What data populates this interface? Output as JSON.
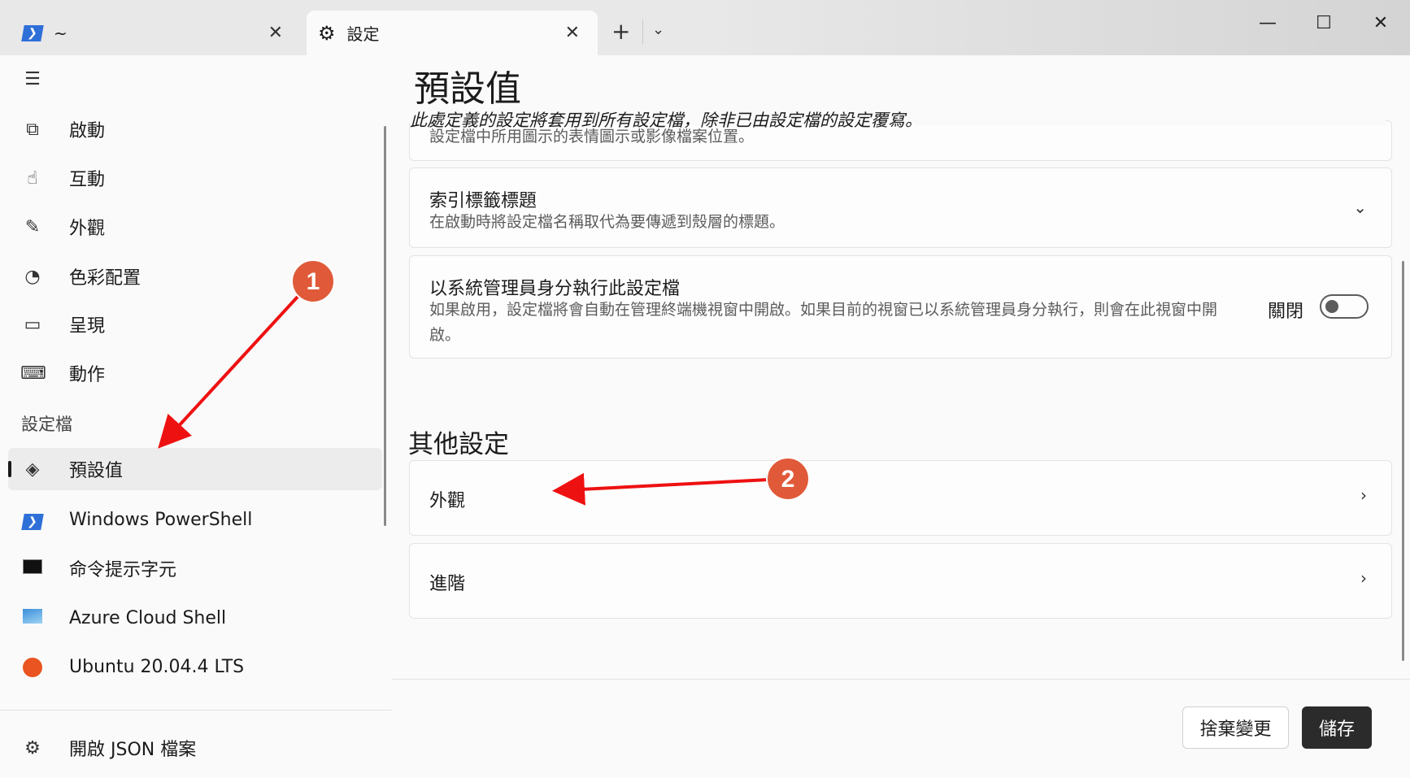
{
  "tabs": [
    {
      "label": "~",
      "icon": "powershell-icon"
    },
    {
      "label": "設定",
      "icon": "gear-icon"
    }
  ],
  "window_controls": {
    "minimize": "—",
    "maximize": "☐",
    "close": "✕"
  },
  "sidebar": {
    "items": [
      {
        "label": "啟動",
        "icon": "startup-icon"
      },
      {
        "label": "互動",
        "icon": "interaction-icon"
      },
      {
        "label": "外觀",
        "icon": "brush-icon"
      },
      {
        "label": "色彩配置",
        "icon": "palette-icon"
      },
      {
        "label": "呈現",
        "icon": "laptop-icon"
      },
      {
        "label": "動作",
        "icon": "keyboard-icon"
      }
    ],
    "profiles_header": "設定檔",
    "profiles": [
      {
        "label": "預設值",
        "icon": "layers-icon",
        "selected": true
      },
      {
        "label": "Windows PowerShell",
        "icon": "powershell-icon"
      },
      {
        "label": "命令提示字元",
        "icon": "cmd-icon"
      },
      {
        "label": "Azure Cloud Shell",
        "icon": "azure-icon"
      },
      {
        "label": "Ubuntu 20.04.4 LTS",
        "icon": "ubuntu-icon"
      }
    ],
    "open_json": "開啟 JSON 檔案"
  },
  "main": {
    "title": "預設值",
    "subtitle": "此處定義的設定將套用到所有設定檔，除非已由設定檔的設定覆寫。",
    "partial_card_desc": "設定檔中所用圖示的表情圖示或影像檔案位置。",
    "tab_title_card": {
      "title": "索引標籤標題",
      "desc": "在啟動時將設定檔名稱取代為要傳遞到殼層的標題。"
    },
    "elevate_card": {
      "title": "以系統管理員身分執行此設定檔",
      "desc": "如果啟用，設定檔將會自動在管理終端機視窗中開啟。如果目前的視窗已以系統管理員身分執行，則會在此視窗中開啟。",
      "toggle_label": "關閉",
      "toggle_on": false
    },
    "other_settings_header": "其他設定",
    "other_settings": [
      {
        "label": "外觀"
      },
      {
        "label": "進階"
      }
    ],
    "discard_label": "捨棄變更",
    "save_label": "儲存"
  },
  "annotations": [
    {
      "label": "1"
    },
    {
      "label": "2"
    }
  ],
  "colors": {
    "annotation": "#e05a3a",
    "arrow": "#ee1111",
    "save_bg": "#2b2b2b"
  }
}
